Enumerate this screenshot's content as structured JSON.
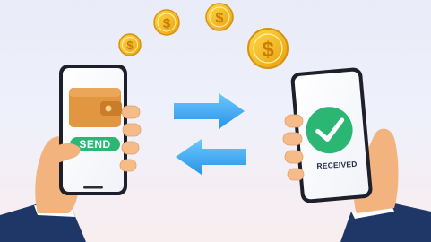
{
  "phones": {
    "sender": {
      "button_label": "SEND",
      "icon": "wallet-icon"
    },
    "receiver": {
      "status_label": "RECEIVED",
      "icon": "checkmark-icon"
    }
  },
  "coins": {
    "symbol": "$",
    "icon": "dollar-coin-icon"
  },
  "arrows": {
    "icons": [
      "arrow-right-icon",
      "arrow-left-icon"
    ]
  },
  "colors": {
    "accent_green": "#2bb673",
    "arrow_blue": "#3aa8f0",
    "coin_gold": "#f5b81e",
    "wallet_orange": "#e1963f",
    "jacket_navy": "#1f3766",
    "skin": "#f3b37e"
  }
}
